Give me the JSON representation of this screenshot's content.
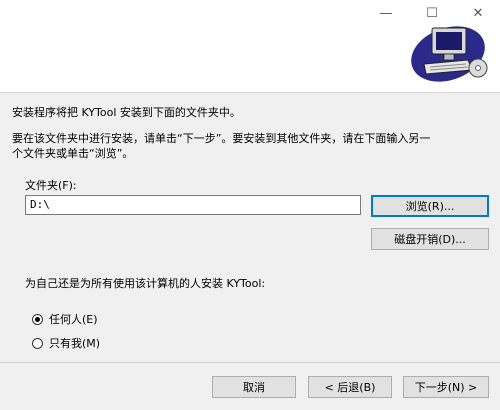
{
  "window": {
    "minimize": "—",
    "maximize": "☐",
    "close": "✕"
  },
  "intro": {
    "line1": "安装程序将把 KYTool 安装到下面的文件夹中。",
    "line2": "要在该文件夹中进行安装，请单击“下一步”。要安装到其他文件夹，请在下面输入另一",
    "line3": "个文件夹或单击“浏览”。"
  },
  "folder": {
    "label": "文件夹(F):",
    "value": "D:\\",
    "browse_label": "浏览(R)...",
    "disk_cost_label": "磁盘开销(D)..."
  },
  "install_for": {
    "prompt": "为自己还是为所有使用该计算机的人安装 KYTool:",
    "options": [
      {
        "label": "任何人(E)",
        "checked": true
      },
      {
        "label": "只有我(M)",
        "checked": false
      }
    ]
  },
  "footer": {
    "cancel_label": "取消",
    "back_label": "< 后退(B)",
    "next_label": "下一步(N) >"
  }
}
